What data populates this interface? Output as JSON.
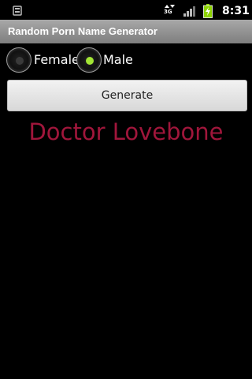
{
  "status_bar": {
    "network_label": "3G",
    "time": "8:31",
    "battery_color": "#8dd400"
  },
  "app": {
    "title": "Random Porn Name Generator"
  },
  "gender_options": [
    {
      "label": "Female",
      "selected": false
    },
    {
      "label": "Male",
      "selected": true
    }
  ],
  "colors": {
    "radio_selected": "#a3e635",
    "radio_unselected": "#3a3a3a",
    "result_text": "#a0163b"
  },
  "generate_button": {
    "label": "Generate"
  },
  "result": {
    "name": "Doctor Lovebone"
  }
}
